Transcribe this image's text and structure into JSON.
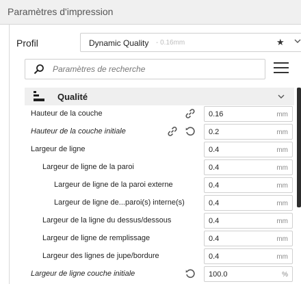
{
  "header": {
    "title": "Paramètres d'impression"
  },
  "profile": {
    "label": "Profil",
    "name": "Dynamic Quality",
    "detail": "- 0.16mm"
  },
  "search": {
    "placeholder": "Paramètres de recherche"
  },
  "category": {
    "label": "Qualité"
  },
  "settings": [
    {
      "label": "Hauteur de la couche",
      "value": "0.16",
      "unit": "mm",
      "italic": false,
      "link": true,
      "reset": false
    },
    {
      "label": "Hauteur de la couche initiale",
      "value": "0.2",
      "unit": "mm",
      "italic": true,
      "link": true,
      "reset": true
    },
    {
      "label": "Largeur de ligne",
      "value": "0.4",
      "unit": "mm",
      "italic": false,
      "link": false,
      "reset": false
    },
    {
      "label": "Largeur de ligne de la paroi",
      "value": "0.4",
      "unit": "mm",
      "italic": false,
      "link": false,
      "reset": false
    },
    {
      "label": "Largeur de ligne de la paroi externe",
      "value": "0.4",
      "unit": "mm",
      "italic": false,
      "link": false,
      "reset": false
    },
    {
      "label": "Largeur de ligne de...paroi(s) interne(s)",
      "value": "0.4",
      "unit": "mm",
      "italic": false,
      "link": false,
      "reset": false
    },
    {
      "label": "Largeur de la ligne du dessus/dessous",
      "value": "0.4",
      "unit": "mm",
      "italic": false,
      "link": false,
      "reset": false
    },
    {
      "label": "Largeur de ligne de remplissage",
      "value": "0.4",
      "unit": "mm",
      "italic": false,
      "link": false,
      "reset": false
    },
    {
      "label": "Largeur des lignes de jupe/bordure",
      "value": "0.4",
      "unit": "mm",
      "italic": false,
      "link": false,
      "reset": false
    },
    {
      "label": "Largeur de ligne couche initiale",
      "value": "100.0",
      "unit": "%",
      "italic": true,
      "link": false,
      "reset": true
    }
  ],
  "icons": {
    "favorite": "star-icon",
    "expand": "chevron-down-icon",
    "search": "search-icon",
    "menu": "hamburger-icon",
    "link": "link-icon",
    "reset": "reset-icon"
  }
}
